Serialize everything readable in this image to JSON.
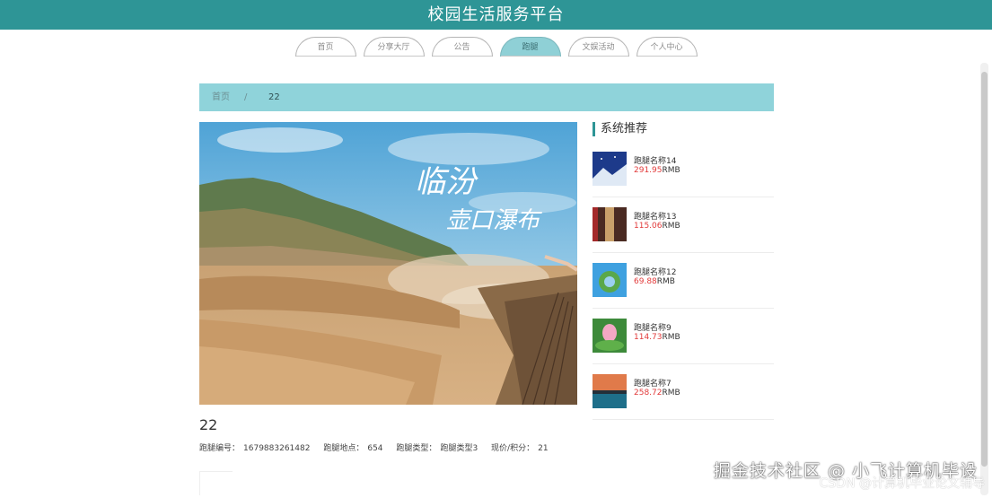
{
  "header": {
    "title": "校园生活服务平台"
  },
  "nav": {
    "tabs": [
      {
        "label": "首页",
        "active": false
      },
      {
        "label": "分享大厅",
        "active": false
      },
      {
        "label": "公告",
        "active": false
      },
      {
        "label": "跑腿",
        "active": true
      },
      {
        "label": "文娱活动",
        "active": false
      },
      {
        "label": "个人中心",
        "active": false
      }
    ]
  },
  "breadcrumb": {
    "home": "首页",
    "separator": "/",
    "current": "22"
  },
  "hero": {
    "calligraphy_line1": "临汾",
    "calligraphy_line2": "壶口瀑布"
  },
  "item": {
    "title": "22",
    "meta": {
      "id_label": "跑腿编号：",
      "id_value": "1679883261482",
      "location_label": "跑腿地点：",
      "location_value": "654",
      "type_label": "跑腿类型：",
      "type_value": "跑腿类型3",
      "price_label": "现价/积分：",
      "price_value": "21"
    }
  },
  "sidebar": {
    "title": "系统推荐",
    "items": [
      {
        "name": "跑腿名称14",
        "price": "291.95",
        "unit": "RMB"
      },
      {
        "name": "跑腿名称13",
        "price": "115.06",
        "unit": "RMB"
      },
      {
        "name": "跑腿名称12",
        "price": "69.88",
        "unit": "RMB"
      },
      {
        "name": "跑腿名称9",
        "price": "114.73",
        "unit": "RMB"
      },
      {
        "name": "跑腿名称7",
        "price": "258.72",
        "unit": "RMB"
      }
    ]
  },
  "watermark": {
    "line1": "掘金技术社区 @ 小飞计算机毕设",
    "line2": "CSDN @计算机毕业论文辅导"
  },
  "colors": {
    "header": "#2e9596",
    "accent": "#8fd3da",
    "price": "#e23b3b"
  }
}
